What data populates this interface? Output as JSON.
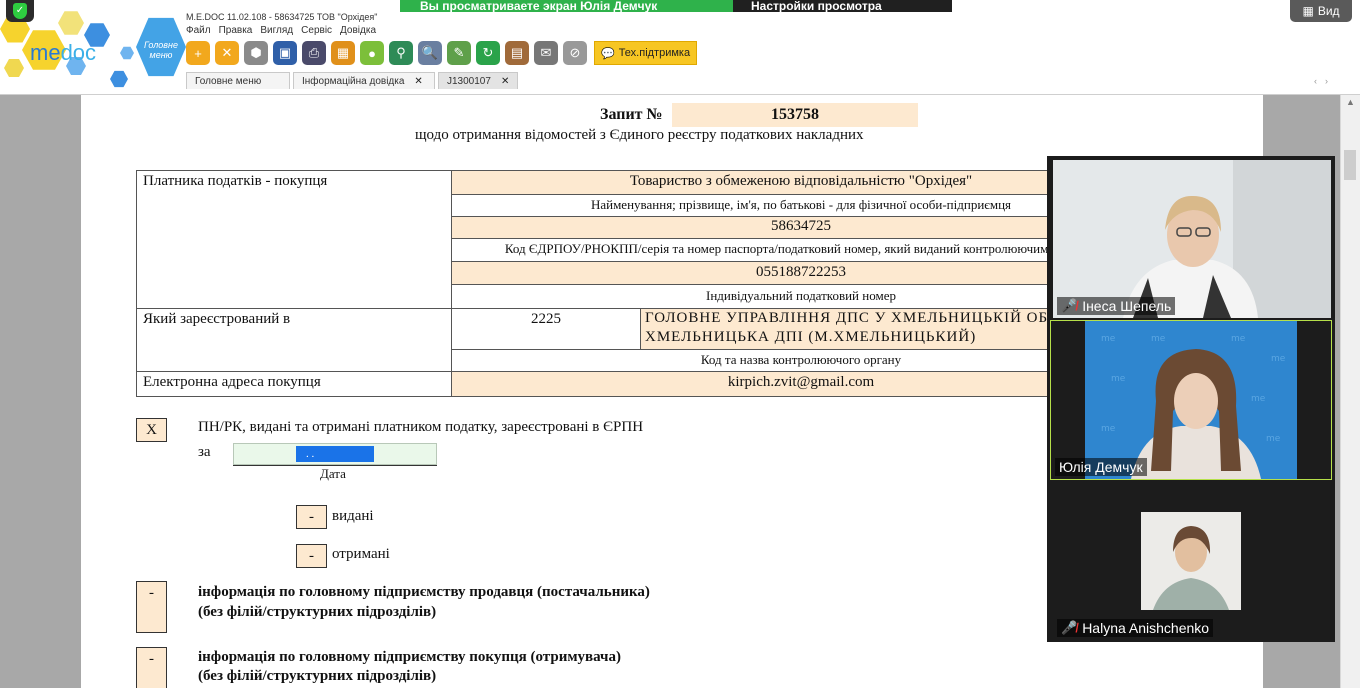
{
  "banner": {
    "sharing_text": "Вы просматриваете экран Юлія Демчук",
    "view_settings": "Настройки просмотра",
    "view_button": "Вид"
  },
  "app": {
    "window_title": "M.E.DOC 11.02.108 - 58634725 ТОВ \"Орхідея\"",
    "main_menu_label": "Головне меню",
    "menu": [
      "Файл",
      "Правка",
      "Вигляд",
      "Сервіс",
      "Довідка"
    ],
    "support_button": "Тех.підтримка",
    "tabs": [
      {
        "label": "Головне меню",
        "closable": false
      },
      {
        "label": "Інформаційна довідка",
        "closable": true
      },
      {
        "label": "J1300107",
        "closable": true
      }
    ],
    "close_glyph": "✕"
  },
  "document": {
    "title": "Запит №",
    "number": "153758",
    "subtitle": "щодо отримання відомостей з Єдиного реєстру податкових накладних",
    "payer_label": "Платника податків - покупця",
    "payer_name": "Товариство з обмеженою відповідальністю \"Орхідея\"",
    "payer_name_hint": "Найменування; прізвище, ім'я, по батькові - для фізичної особи-підприємця",
    "edrpou": "58634725",
    "edrpou_hint": "Код ЄДРПОУ/РНОКПП/серія та номер паспорта/податковий номер, який виданий контролюючим органом",
    "ipn": "055188722253",
    "ipn_hint": "Індивідуальний податковий номер",
    "registered_label": "Який зареєстрований в",
    "authority_code": "2225",
    "authority_name": "ГОЛОВНЕ УПРАВЛІННЯ ДПС У ХМЕЛЬНИЦЬКІЙ ОБЛАСТІ, ХМЕЛЬНИЦЬКА ДПІ (М.ХМЕЛЬНИЦЬКИЙ)",
    "authority_hint": "Код та назва контролюючого органу",
    "email_label": "Електронна адреса покупця",
    "email": "kirpich.zvit@gmail.com",
    "opt1_mark": "X",
    "opt1_text": "ПН/РК, видані та отримані платником податку, зареєстровані в ЄРПН",
    "za": "за",
    "date_value": ". .",
    "date_label": "Дата",
    "issued_mark": "-",
    "issued_label": "видані",
    "received_mark": "-",
    "received_label": "отримані",
    "opt2_mark": "-",
    "opt2_line1": "інформація по головному підприємству продавця (постачальника)",
    "opt2_line2": "(без філій/структурних  підрозділів)",
    "opt3_mark": "-",
    "opt3_line1": "інформація по головному підприємству покупця (отримувача)",
    "opt3_line2": "(без філій/структурних  підрозділів)"
  },
  "participants": [
    {
      "name": "Інеса Шепель",
      "muted": true
    },
    {
      "name": "Юлія Демчук",
      "muted": false
    },
    {
      "name": "Halyna Anishchenko",
      "muted": true
    }
  ],
  "colors": {
    "accent_green": "#2fb24b",
    "field_peach": "#fde9d0",
    "selection_blue": "#1a73e8",
    "support_yellow": "#f7c623"
  }
}
